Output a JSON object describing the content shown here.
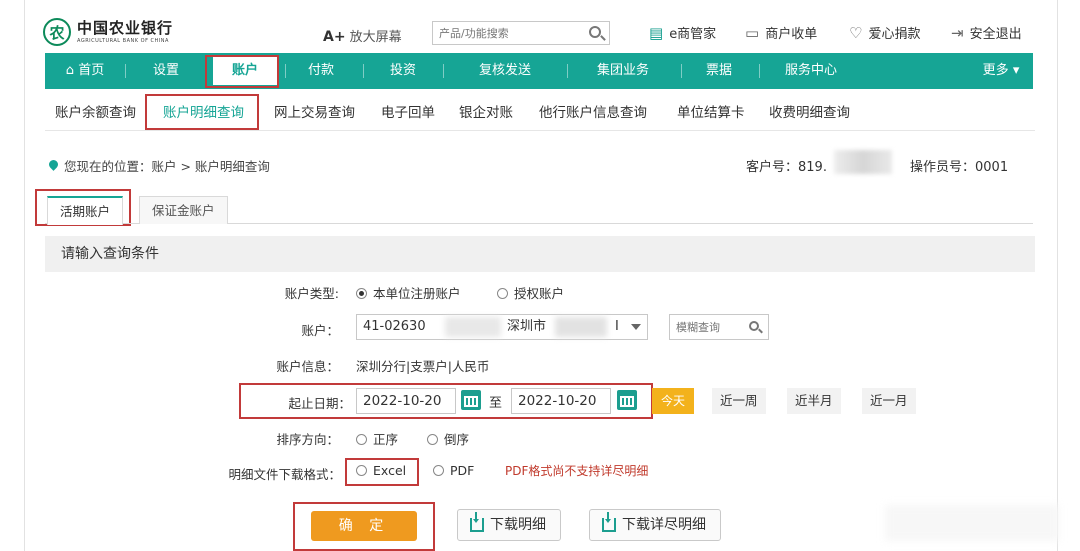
{
  "header": {
    "logo_cn": "中国农业银行",
    "logo_en": "AGRICULTURAL BANK OF CHINA",
    "bigscreen_prefix": "A+",
    "bigscreen_label": "放大屏幕",
    "search_placeholder": "产品/功能搜索",
    "links": [
      "e商管家",
      "商户收单",
      "爱心捐款",
      "安全退出"
    ]
  },
  "nav": {
    "items": [
      "首页",
      "设置",
      "账户",
      "付款",
      "投资",
      "复核发送",
      "集团业务",
      "票据",
      "服务中心"
    ],
    "more": "更多",
    "active": "账户"
  },
  "subnav": {
    "items": [
      "账户余额查询",
      "账户明细查询",
      "网上交易查询",
      "电子回单",
      "银企对账",
      "他行账户信息查询",
      "单位结算卡",
      "收费明细查询"
    ],
    "active": "账户明细查询"
  },
  "breadcrumb": {
    "text": "您现在的位置：账户 > 账户明细查询",
    "customer_label": "客户号：819.",
    "operator": "操作员号：0001"
  },
  "tabs": [
    "活期账户",
    "保证金账户"
  ],
  "panel_title": "请输入查询条件",
  "form": {
    "account_type_label": "账户类型:",
    "account_type_options": [
      "本单位注册账户",
      "授权账户"
    ],
    "account_label": "账户：",
    "account_value_prefix": "41-02630",
    "account_value_city": "深圳市",
    "account_value_tail": "I",
    "fuzzy_placeholder": "模糊查询",
    "account_info_label": "账户信息：",
    "account_info_value": "深圳分行|支票户|人民币",
    "date_label": "起止日期：",
    "date_from": "2022-10-20",
    "date_to_sep": "至",
    "date_to": "2022-10-20",
    "today": "今天",
    "ranges": [
      "近一周",
      "近半月",
      "近一月"
    ],
    "sort_label": "排序方向：",
    "sort_options": [
      "正序",
      "倒序"
    ],
    "format_label": "明细文件下载格式：",
    "format_options": [
      "Excel",
      "PDF"
    ],
    "pdf_note": "PDF格式尚不支持详尽明细"
  },
  "buttons": {
    "confirm": "确 定",
    "download": "下载明细",
    "download_detail": "下载详尽明细"
  }
}
